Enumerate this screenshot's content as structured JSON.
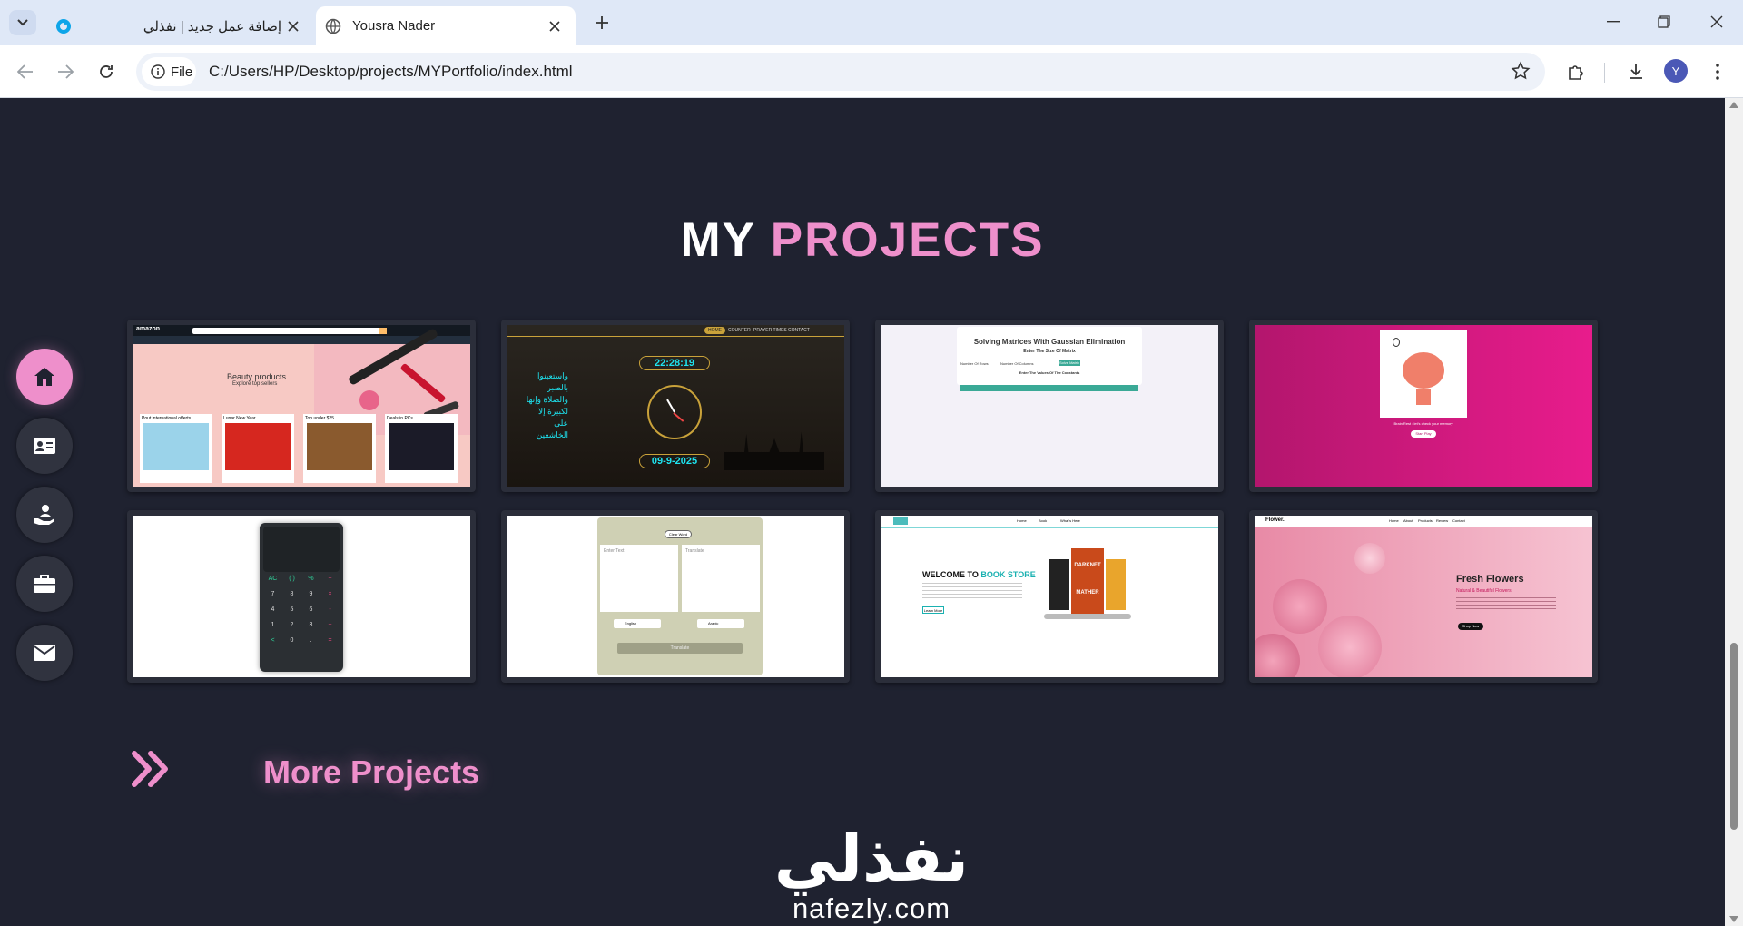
{
  "browser": {
    "tabs": [
      {
        "title": "إضافة عمل جديد | نفذلي",
        "active": false
      },
      {
        "title": "Yousra Nader",
        "active": true
      }
    ],
    "address": {
      "chip_label": "File",
      "url": "C:/Users/HP/Desktop/projects/MYPortfolio/index.html"
    },
    "profile_initial": "Y"
  },
  "page": {
    "title_white": "MY",
    "title_pink": "PROJECTS",
    "more_label": "More Projects",
    "accent": "#ee8fcb",
    "background": "#1f2230"
  },
  "sidenav": [
    {
      "name": "home-icon",
      "active": true
    },
    {
      "name": "id-card-icon",
      "active": false
    },
    {
      "name": "hand-person-icon",
      "active": false
    },
    {
      "name": "briefcase-icon",
      "active": false
    },
    {
      "name": "envelope-icon",
      "active": false
    }
  ],
  "projects": {
    "amazon": {
      "logo": "amazon",
      "hero": "Beauty products",
      "sub": "Explore top sellers",
      "tiles": [
        "Pout international offerts",
        "Lunar New Year",
        "Top under $25",
        "Deals in PCs"
      ]
    },
    "clock": {
      "time": "22:28:19",
      "date": "09-9-2025",
      "nav": [
        "HOME",
        "COUNTER",
        "PRAYER TIMES",
        "CONTACT"
      ],
      "verse": "واستعينوا بالصبر والصلاة وإنها لكبيرة إلا على الخاشعين"
    },
    "matrix": {
      "title": "Solving Matrices With Gaussian Elimination",
      "enter_size": "Enter The Size Of Matrix",
      "rows": "Number Of Rows",
      "cols": "Number Of Columns",
      "enter_values": "Enter The Values Of The Constants",
      "button": "Solve Matrix"
    },
    "brain": {
      "text": "Brain Rest : let's check your memory",
      "button": "Start Play"
    },
    "calculator": {
      "keys": [
        "AC",
        "( )",
        "%",
        "÷",
        "7",
        "8",
        "9",
        "×",
        "4",
        "5",
        "6",
        "-",
        "1",
        "2",
        "3",
        "+",
        "<",
        "0",
        ".",
        "="
      ]
    },
    "translator": {
      "clear": "Clear Word",
      "enter": "Enter Text",
      "translate_ph": "Translate",
      "from": "English",
      "to": "Arabic",
      "button": "Translate"
    },
    "bookstore": {
      "nav": [
        "Home",
        "Book",
        "What's Here"
      ],
      "welcome": "WELCOME TO",
      "store": "BOOK STORE",
      "button": "Learn More",
      "book": "DARKNET MATHER"
    },
    "flowers": {
      "logo": "Flower.",
      "nav": [
        "Home",
        "About",
        "Products",
        "Review",
        "Contact"
      ],
      "heading": "Fresh Flowers",
      "sub": "Natural & Beautiful Flowers",
      "button": "Shop Now"
    }
  },
  "watermark": {
    "arabic": "نفذلي",
    "latin": "nafezly.com"
  }
}
